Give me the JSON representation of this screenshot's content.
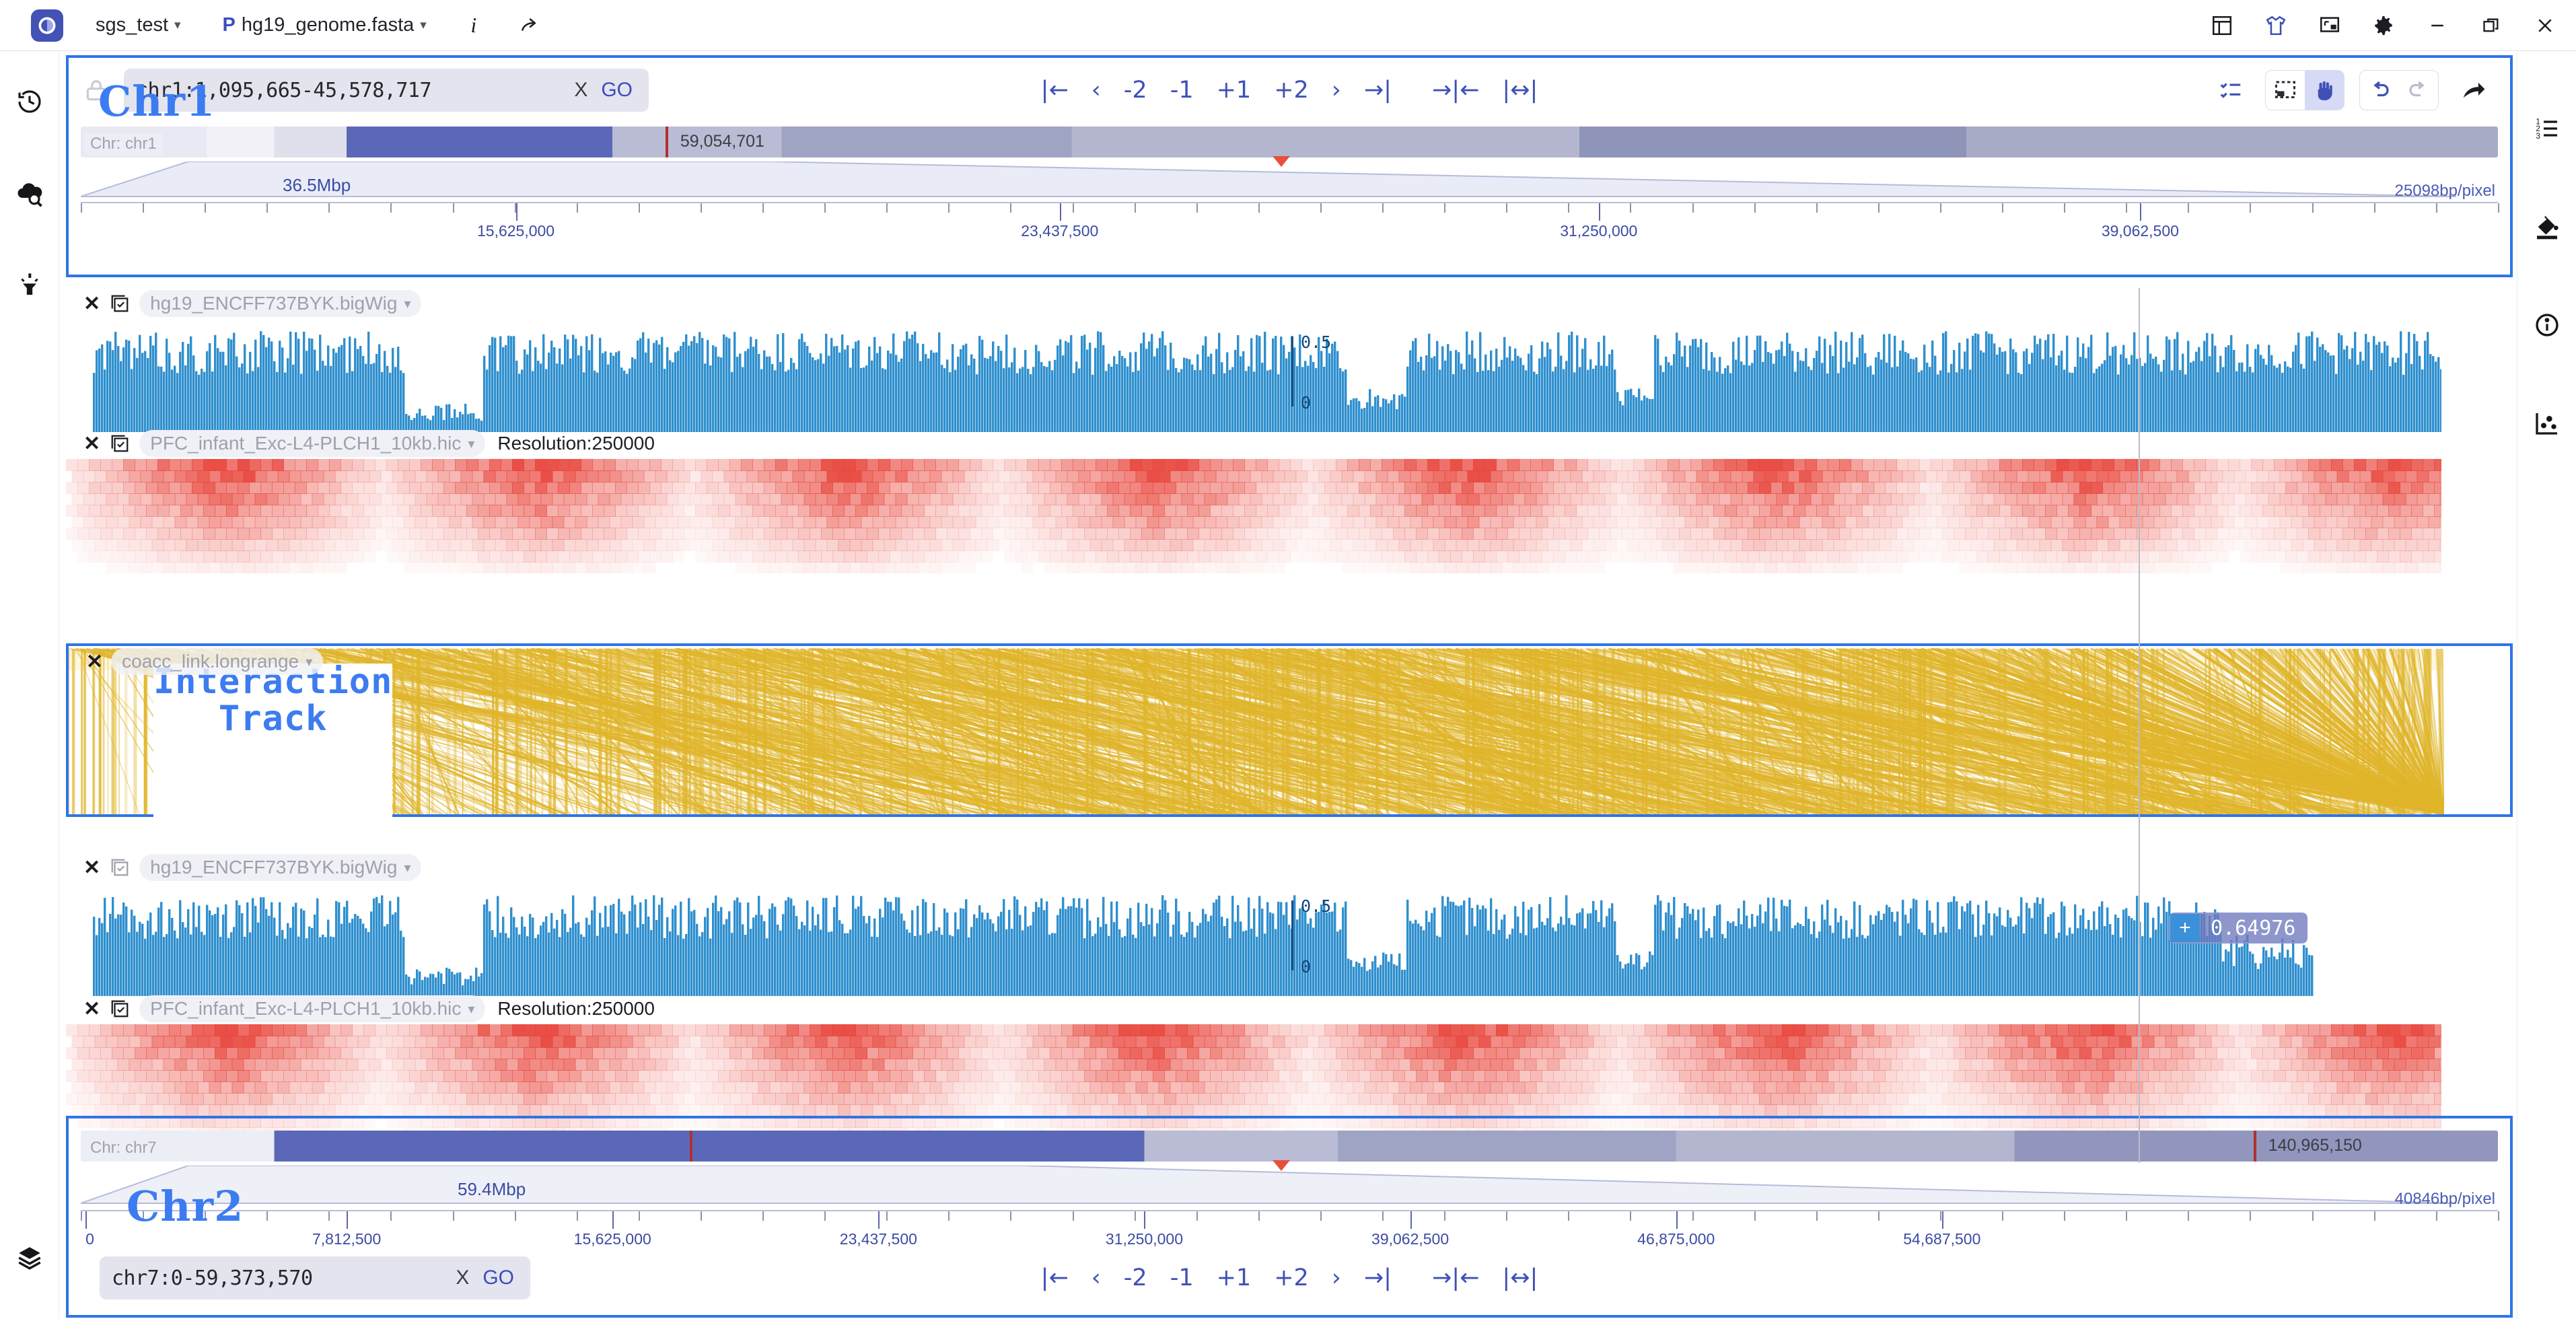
{
  "titlebar": {
    "logo": "G",
    "session": "sgs_test",
    "genome_prefix": "P",
    "genome": "hg19_genome.fasta",
    "info_icon": "info-icon",
    "share_icon": "share-icon",
    "icons": [
      "layout-panel-icon",
      "shirt-icon",
      "screen-icon",
      "gear-icon"
    ],
    "window": [
      "minimize-icon",
      "restore-icon",
      "close-icon"
    ]
  },
  "leftbar": {
    "items": [
      "history-icon",
      "cloud-search-icon",
      "highlighter-icon",
      "layers-icon"
    ]
  },
  "rightbar": {
    "items": [
      "ordered-list-icon",
      "paint-bucket-icon",
      "info-circle-icon",
      "scatter-plot-icon"
    ]
  },
  "top_nav": {
    "search_value": "chr1:1,095,665-45,578,717",
    "clear_label": "X",
    "go_label": "GO",
    "buttons": [
      "|←",
      "‹",
      "-2",
      "-1",
      "+1",
      "+2",
      "›",
      "→|"
    ],
    "fit_buttons": [
      "→|←",
      "|↔|"
    ],
    "tools": [
      "checklist-icon",
      "marquee-select-icon",
      "hand-pan-icon",
      "undo-icon",
      "redo-icon",
      "share-arrow-icon"
    ],
    "active_tool": "hand-pan-icon"
  },
  "bottom_nav": {
    "search_value": "chr7:0-59,373,570",
    "clear_label": "X",
    "go_label": "GO",
    "buttons": [
      "|←",
      "‹",
      "-2",
      "-1",
      "+1",
      "+2",
      "›",
      "→|"
    ],
    "fit_buttons": [
      "→|←",
      "|↔|"
    ]
  },
  "region_top": {
    "chrom_label": "Chr: chr1",
    "span_label": "36.5Mbp",
    "marker_pos": "59,054,701",
    "bp_per_pixel": "25098bp/pixel",
    "ticks": [
      "15,625,000",
      "23,437,500",
      "31,250,000",
      "39,062,500"
    ],
    "tick_pct": [
      18.0,
      40.5,
      62.8,
      85.2
    ]
  },
  "region_bottom": {
    "chrom_label": "Chr: chr7",
    "span_label": "59.4Mbp",
    "marker_pos": "140,965,150",
    "bp_per_pixel": "40846bp/pixel",
    "ticks": [
      "0",
      "7,812,500",
      "15,625,000",
      "23,437,500",
      "31,250,000",
      "39,062,500",
      "46,875,000",
      "54,687,500"
    ],
    "tick_pct": [
      0.2,
      11.0,
      22.0,
      33.0,
      44.0,
      55.0,
      66.0,
      77.0
    ]
  },
  "tracks": [
    {
      "id": "bigwig-1",
      "name": "hg19_ENCFF737BYK.bigWig",
      "type": "bigwig",
      "axis_max": "0.5",
      "axis_min": "0",
      "color": "#2f8fce"
    },
    {
      "id": "hic-1",
      "name": "PFC_infant_Exc-L4-PLCH1_10kb.hic",
      "type": "hic",
      "extra": "Resolution:250000",
      "color": "#e8463c"
    },
    {
      "id": "longrange-1",
      "name": "coacc_link.longrange",
      "type": "interaction",
      "color": "#e0b52a"
    },
    {
      "id": "bigwig-2",
      "name": "hg19_ENCFF737BYK.bigWig",
      "type": "bigwig",
      "axis_max": "0.5",
      "axis_min": "0",
      "color": "#2f8fce"
    },
    {
      "id": "hic-2",
      "name": "PFC_infant_Exc-L4-PLCH1_10kb.hic",
      "type": "hic",
      "extra": "Resolution:250000",
      "color": "#e8463c"
    }
  ],
  "tooltip": {
    "sign": "+",
    "value": "0.64976"
  },
  "annotations": [
    {
      "id": "anno-chr1",
      "text": "Chr1"
    },
    {
      "id": "anno-chr2",
      "text": "Chr2"
    },
    {
      "id": "anno-interaction-1",
      "text": "Interaction"
    },
    {
      "id": "anno-interaction-2",
      "text": "Track"
    }
  ],
  "colors": {
    "accent_blue": "#3f51b5",
    "highlight_border": "#2f74e8",
    "bigwig": "#2f8fce",
    "hic": "#e8463c",
    "interaction": "#e0b52a",
    "ideogram_band": "#5b68b8"
  }
}
